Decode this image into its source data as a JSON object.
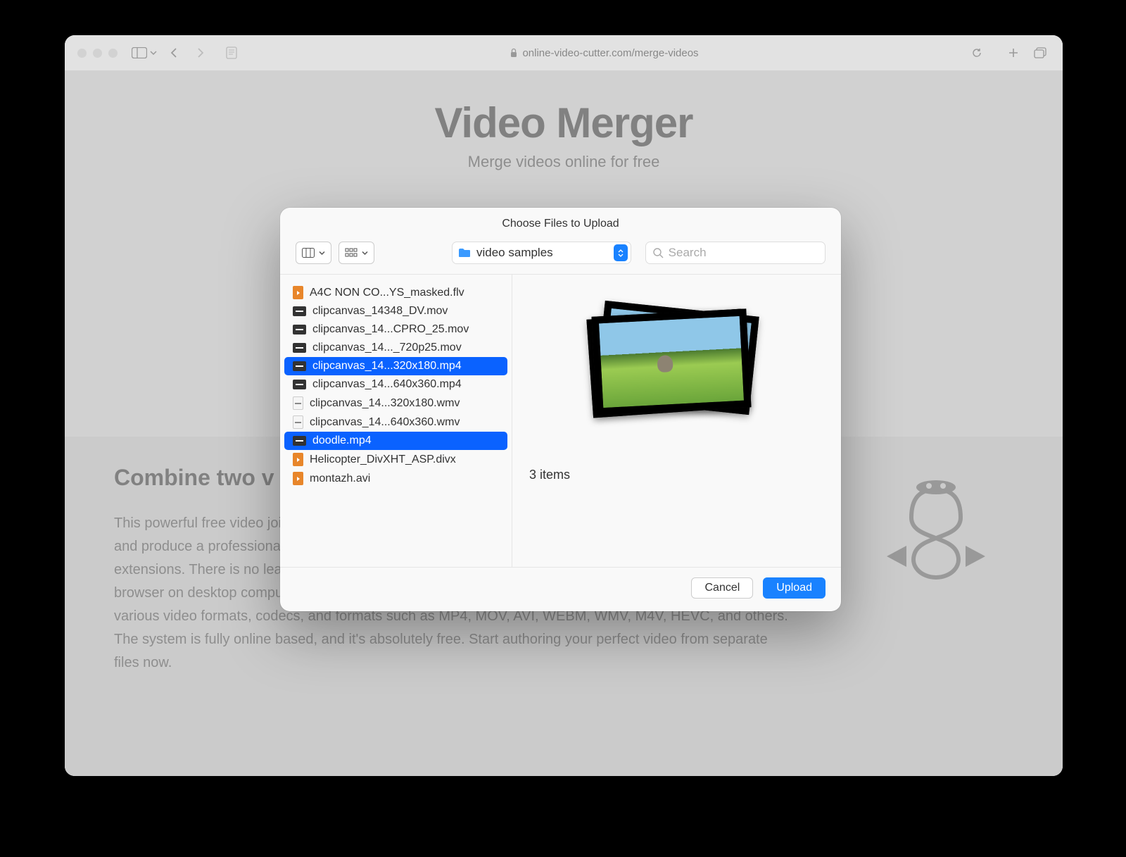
{
  "browser": {
    "url": "online-video-cutter.com/merge-videos"
  },
  "page": {
    "title": "Video Merger",
    "subtitle": "Merge videos online for free",
    "section_heading": "Combine two v",
    "body": "This powerful free video joiner lets you combine a few clips into one video, crop the result any way you want, and produce a professional-looking clip. You do not need to install any software, codecs, or browser extensions. There is no learning curve, and the UI has every tool you need. This Video Merger works in a browser on desktop computers and mobile devices, such as smartphones or tablets. The platform supports various video formats, codecs, and formats such as MP4, MOV, AVI, WEBM, WMV, M4V, HEVC, and others. The system is fully online based, and it's absolutely free. Start authoring your perfect video from separate files now."
  },
  "dialog": {
    "title": "Choose Files to Upload",
    "location": "video samples",
    "search_placeholder": "Search",
    "items_caption": "3 items",
    "files": [
      {
        "name": "A4C NON CO...YS_masked.flv",
        "icon": "orange",
        "selected": false
      },
      {
        "name": "clipcanvas_14348_DV.mov",
        "icon": "dark",
        "selected": false
      },
      {
        "name": "clipcanvas_14...CPRO_25.mov",
        "icon": "dark",
        "selected": false
      },
      {
        "name": "clipcanvas_14..._720p25.mov",
        "icon": "dark",
        "selected": false
      },
      {
        "name": "clipcanvas_14...320x180.mp4",
        "icon": "dark",
        "selected": true
      },
      {
        "name": "clipcanvas_14...640x360.mp4",
        "icon": "dark",
        "selected": false
      },
      {
        "name": "clipcanvas_14...320x180.wmv",
        "icon": "wmv",
        "selected": false
      },
      {
        "name": "clipcanvas_14...640x360.wmv",
        "icon": "wmv",
        "selected": false
      },
      {
        "name": "doodle.mp4",
        "icon": "dark",
        "selected": true
      },
      {
        "name": "Helicopter_DivXHT_ASP.divx",
        "icon": "orange",
        "selected": false
      },
      {
        "name": "montazh.avi",
        "icon": "orange",
        "selected": false
      }
    ],
    "cancel": "Cancel",
    "upload": "Upload"
  }
}
